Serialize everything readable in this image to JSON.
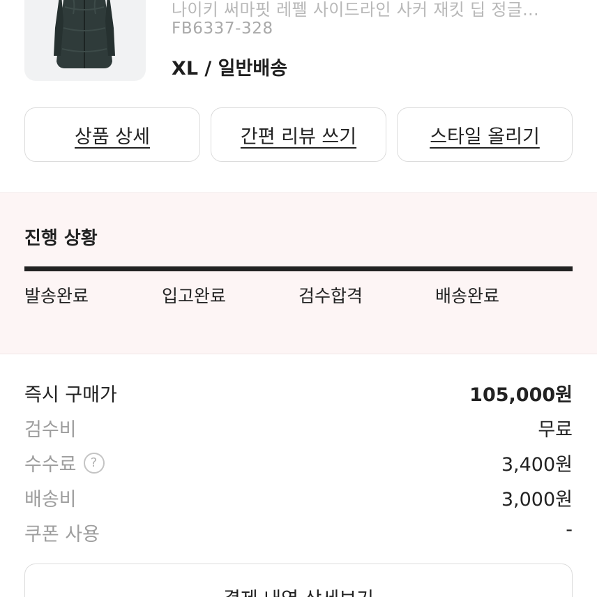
{
  "product": {
    "name": "나이키 써마핏 레펠 사이드라인 사커 재킷 딥 정글...",
    "code": "FB6337-328",
    "option": "XL / 일반배송"
  },
  "actions": {
    "detail": "상품 상세",
    "review": "간편 리뷰 쓰기",
    "style": "스타일 올리기"
  },
  "progress": {
    "title": "진행 상황",
    "steps": [
      "발송완료",
      "입고완료",
      "검수합격",
      "배송완료"
    ],
    "completed_fraction": 1.0
  },
  "pricing": {
    "buy_now": {
      "label": "즉시 구매가",
      "value": "105,000원"
    },
    "inspection": {
      "label": "검수비",
      "value": "무료"
    },
    "fee": {
      "label": "수수료",
      "help": "?",
      "value": "3,400원"
    },
    "shipping": {
      "label": "배송비",
      "value": "3,000원"
    },
    "coupon": {
      "label": "쿠폰 사용",
      "value": "-"
    }
  },
  "bottom": {
    "detail_button": "결제 내역 상세보기"
  },
  "colors": {
    "progress_bg": "#fdf5f5",
    "progress_fill": "#222222",
    "muted_text": "#9e9e9e"
  }
}
